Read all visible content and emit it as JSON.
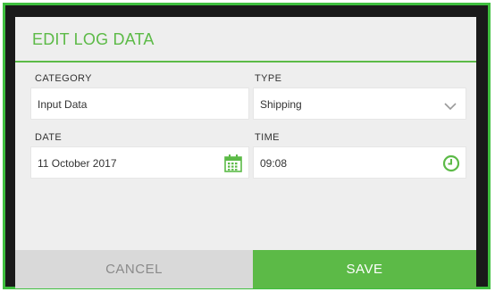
{
  "dialog": {
    "title": "EDIT LOG DATA",
    "category": {
      "label": "CATEGORY",
      "value": "Input Data"
    },
    "type": {
      "label": "TYPE",
      "value": "Shipping",
      "icon": "chevron-down-icon"
    },
    "date": {
      "label": "DATE",
      "value": "11 October 2017",
      "icon": "calendar-icon"
    },
    "time": {
      "label": "TIME",
      "value": "09:08",
      "icon": "clock-icon"
    },
    "cancel_label": "CANCEL",
    "save_label": "SAVE"
  },
  "colors": {
    "accent": "#5cba47",
    "frame_border": "#3fbf3f",
    "dialog_bg": "#eeeeee",
    "cancel_bg": "#d9d9d9"
  }
}
